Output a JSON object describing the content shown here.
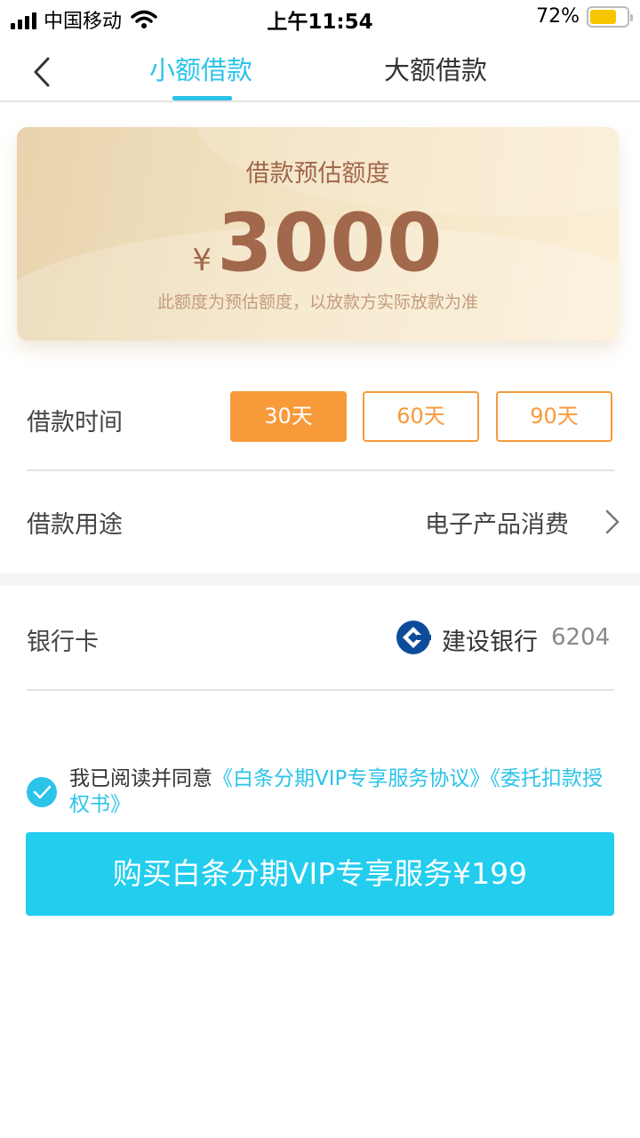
{
  "status_bar": {
    "carrier": "中国移动",
    "time": "上午11:54",
    "battery": "72%",
    "battery_level": 0.72
  },
  "nav": {
    "tabs": [
      {
        "label": "小额借款",
        "active": true
      },
      {
        "label": "大额借款",
        "active": false
      }
    ]
  },
  "card": {
    "title": "借款预估额度",
    "currency": "¥",
    "amount": "3000",
    "note": "此额度为预估额度，以放款方实际放款为准"
  },
  "loan_term": {
    "label": "借款时间",
    "options": [
      {
        "label": "30天",
        "selected": true
      },
      {
        "label": "60天",
        "selected": false
      },
      {
        "label": "90天",
        "selected": false
      }
    ]
  },
  "loan_purpose": {
    "label": "借款用途",
    "value": "电子产品消费"
  },
  "bank_card": {
    "label": "银行卡",
    "bank": "建设银行",
    "number": "6204"
  },
  "agreement": {
    "prefix": "我已阅读并同意",
    "link1": "《白条分期VIP专享服务协议》",
    "link2": "《委托扣款授权书》",
    "checked": true
  },
  "purchase_button": "购买白条分期VIP专享服务¥199",
  "colors": {
    "accent": "#2cc3e8",
    "button": "#22cdee",
    "orange": "#f79a3a",
    "card_text": "#a2684b"
  }
}
